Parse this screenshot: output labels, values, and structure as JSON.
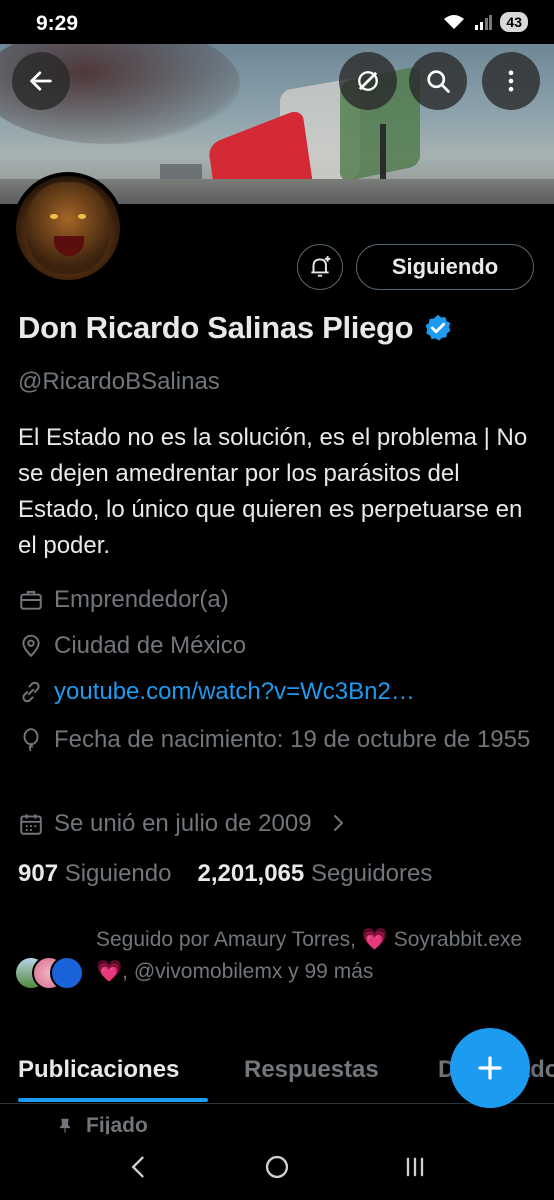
{
  "status_bar": {
    "time": "9:29",
    "battery": "43"
  },
  "profile": {
    "name": "Don Ricardo Salinas Pliego",
    "handle": "@RicardoBSalinas",
    "bio": "El Estado no es la solución, es el problema | No se dejen amedrentar por los parásitos del Estado, lo único que quieren es perpetuarse en el poder.",
    "follow_label": "Siguiendo",
    "verified": true
  },
  "meta": {
    "profession": "Emprendedor(a)",
    "location": "Ciudad de México",
    "website": "youtube.com/watch?v=Wc3Bn2…",
    "birthdate": "Fecha de nacimiento: 19 de octubre de 1955",
    "joined": "Se unió en julio de 2009"
  },
  "stats": {
    "following_count": "907",
    "following_label": "Siguiendo",
    "followers_count": "2,201,065",
    "followers_label": "Seguidores"
  },
  "followed_by": "Seguido por Amaury Torres, 💗 Soyrabbit.exe 💗, @vivomobilemx y 99 más",
  "tabs": [
    {
      "label": "Publicaciones",
      "active": true
    },
    {
      "label": "Respuestas",
      "active": false
    },
    {
      "label": "Destacados",
      "active": false
    }
  ],
  "pinned_label": "Fijado",
  "colors": {
    "accent": "#1d9bf0",
    "background": "#000000",
    "muted": "#71767b",
    "text": "#e7e9ea"
  },
  "icons": [
    "back-arrow-icon",
    "grok-icon",
    "search-icon",
    "more-vertical-icon",
    "bell-plus-icon",
    "verified-badge-icon",
    "briefcase-icon",
    "location-pin-icon",
    "link-icon",
    "balloon-icon",
    "calendar-icon",
    "chevron-right-icon",
    "plus-icon",
    "pin-icon",
    "nav-back-icon",
    "nav-home-icon",
    "nav-recents-icon"
  ]
}
